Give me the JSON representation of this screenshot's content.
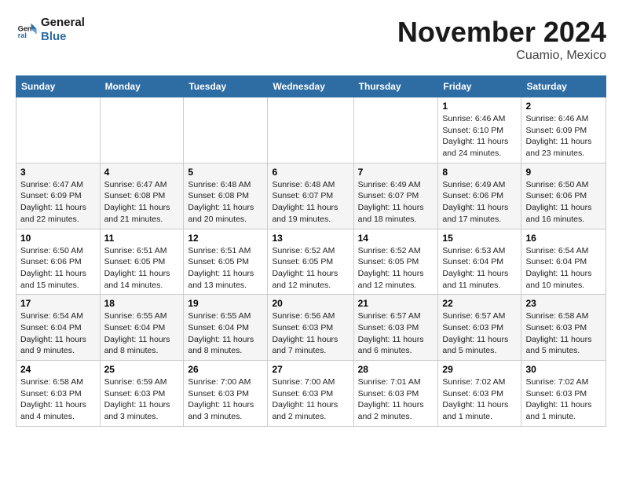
{
  "logo": {
    "line1": "General",
    "line2": "Blue"
  },
  "title": "November 2024",
  "subtitle": "Cuamio, Mexico",
  "days_of_week": [
    "Sunday",
    "Monday",
    "Tuesday",
    "Wednesday",
    "Thursday",
    "Friday",
    "Saturday"
  ],
  "weeks": [
    [
      {
        "day": "",
        "info": ""
      },
      {
        "day": "",
        "info": ""
      },
      {
        "day": "",
        "info": ""
      },
      {
        "day": "",
        "info": ""
      },
      {
        "day": "",
        "info": ""
      },
      {
        "day": "1",
        "info": "Sunrise: 6:46 AM\nSunset: 6:10 PM\nDaylight: 11 hours and 24 minutes."
      },
      {
        "day": "2",
        "info": "Sunrise: 6:46 AM\nSunset: 6:09 PM\nDaylight: 11 hours and 23 minutes."
      }
    ],
    [
      {
        "day": "3",
        "info": "Sunrise: 6:47 AM\nSunset: 6:09 PM\nDaylight: 11 hours and 22 minutes."
      },
      {
        "day": "4",
        "info": "Sunrise: 6:47 AM\nSunset: 6:08 PM\nDaylight: 11 hours and 21 minutes."
      },
      {
        "day": "5",
        "info": "Sunrise: 6:48 AM\nSunset: 6:08 PM\nDaylight: 11 hours and 20 minutes."
      },
      {
        "day": "6",
        "info": "Sunrise: 6:48 AM\nSunset: 6:07 PM\nDaylight: 11 hours and 19 minutes."
      },
      {
        "day": "7",
        "info": "Sunrise: 6:49 AM\nSunset: 6:07 PM\nDaylight: 11 hours and 18 minutes."
      },
      {
        "day": "8",
        "info": "Sunrise: 6:49 AM\nSunset: 6:06 PM\nDaylight: 11 hours and 17 minutes."
      },
      {
        "day": "9",
        "info": "Sunrise: 6:50 AM\nSunset: 6:06 PM\nDaylight: 11 hours and 16 minutes."
      }
    ],
    [
      {
        "day": "10",
        "info": "Sunrise: 6:50 AM\nSunset: 6:06 PM\nDaylight: 11 hours and 15 minutes."
      },
      {
        "day": "11",
        "info": "Sunrise: 6:51 AM\nSunset: 6:05 PM\nDaylight: 11 hours and 14 minutes."
      },
      {
        "day": "12",
        "info": "Sunrise: 6:51 AM\nSunset: 6:05 PM\nDaylight: 11 hours and 13 minutes."
      },
      {
        "day": "13",
        "info": "Sunrise: 6:52 AM\nSunset: 6:05 PM\nDaylight: 11 hours and 12 minutes."
      },
      {
        "day": "14",
        "info": "Sunrise: 6:52 AM\nSunset: 6:05 PM\nDaylight: 11 hours and 12 minutes."
      },
      {
        "day": "15",
        "info": "Sunrise: 6:53 AM\nSunset: 6:04 PM\nDaylight: 11 hours and 11 minutes."
      },
      {
        "day": "16",
        "info": "Sunrise: 6:54 AM\nSunset: 6:04 PM\nDaylight: 11 hours and 10 minutes."
      }
    ],
    [
      {
        "day": "17",
        "info": "Sunrise: 6:54 AM\nSunset: 6:04 PM\nDaylight: 11 hours and 9 minutes."
      },
      {
        "day": "18",
        "info": "Sunrise: 6:55 AM\nSunset: 6:04 PM\nDaylight: 11 hours and 8 minutes."
      },
      {
        "day": "19",
        "info": "Sunrise: 6:55 AM\nSunset: 6:04 PM\nDaylight: 11 hours and 8 minutes."
      },
      {
        "day": "20",
        "info": "Sunrise: 6:56 AM\nSunset: 6:03 PM\nDaylight: 11 hours and 7 minutes."
      },
      {
        "day": "21",
        "info": "Sunrise: 6:57 AM\nSunset: 6:03 PM\nDaylight: 11 hours and 6 minutes."
      },
      {
        "day": "22",
        "info": "Sunrise: 6:57 AM\nSunset: 6:03 PM\nDaylight: 11 hours and 5 minutes."
      },
      {
        "day": "23",
        "info": "Sunrise: 6:58 AM\nSunset: 6:03 PM\nDaylight: 11 hours and 5 minutes."
      }
    ],
    [
      {
        "day": "24",
        "info": "Sunrise: 6:58 AM\nSunset: 6:03 PM\nDaylight: 11 hours and 4 minutes."
      },
      {
        "day": "25",
        "info": "Sunrise: 6:59 AM\nSunset: 6:03 PM\nDaylight: 11 hours and 3 minutes."
      },
      {
        "day": "26",
        "info": "Sunrise: 7:00 AM\nSunset: 6:03 PM\nDaylight: 11 hours and 3 minutes."
      },
      {
        "day": "27",
        "info": "Sunrise: 7:00 AM\nSunset: 6:03 PM\nDaylight: 11 hours and 2 minutes."
      },
      {
        "day": "28",
        "info": "Sunrise: 7:01 AM\nSunset: 6:03 PM\nDaylight: 11 hours and 2 minutes."
      },
      {
        "day": "29",
        "info": "Sunrise: 7:02 AM\nSunset: 6:03 PM\nDaylight: 11 hours and 1 minute."
      },
      {
        "day": "30",
        "info": "Sunrise: 7:02 AM\nSunset: 6:03 PM\nDaylight: 11 hours and 1 minute."
      }
    ]
  ]
}
